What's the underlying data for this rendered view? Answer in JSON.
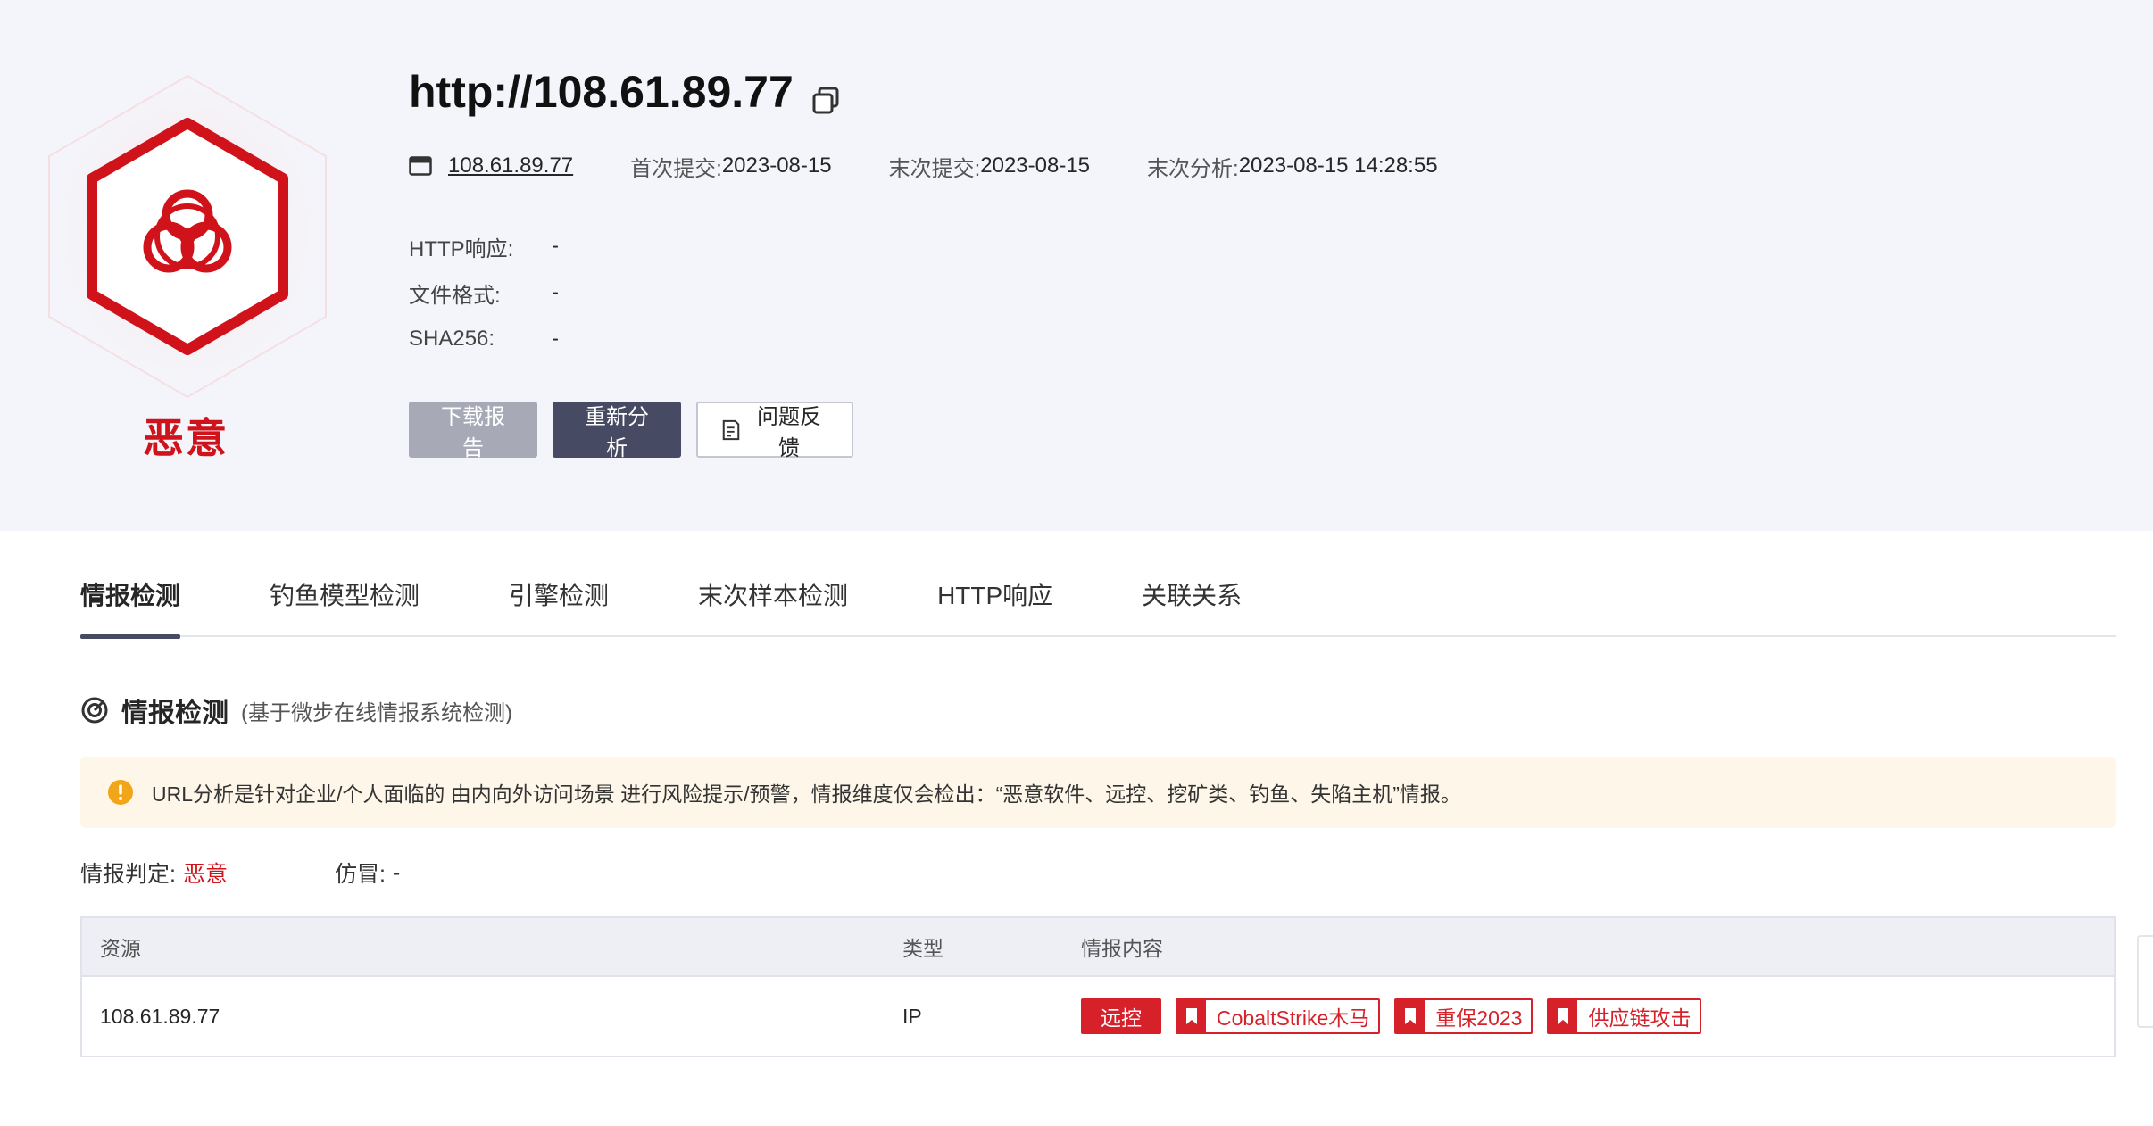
{
  "header": {
    "verdict": "恶意",
    "url": "http://108.61.89.77",
    "host": "108.61.89.77",
    "meta": [
      {
        "label": "首次提交:",
        "value": "2023-08-15"
      },
      {
        "label": "末次提交:",
        "value": "2023-08-15"
      },
      {
        "label": "末次分析:",
        "value": "2023-08-15 14:28:55"
      }
    ],
    "info": [
      {
        "label": "HTTP响应:",
        "value": "-"
      },
      {
        "label": "文件格式:",
        "value": "-"
      },
      {
        "label": "SHA256:",
        "value": "-"
      }
    ],
    "buttons": {
      "download": "下载报告",
      "reanalyze": "重新分析",
      "feedback": "问题反馈"
    }
  },
  "tabs": [
    "情报检测",
    "钓鱼模型检测",
    "引擎检测",
    "末次样本检测",
    "HTTP响应",
    "关联关系"
  ],
  "section": {
    "title": "情报检测",
    "subtitle": "(基于微步在线情报系统检测)",
    "notice": "URL分析是针对企业/个人面临的 由内向外访问场景 进行风险提示/预警，情报维度仅会检出：“恶意软件、远控、挖矿类、钓鱼、失陷主机”情报。",
    "judgement_label": "情报判定:",
    "judgement_value": "恶意",
    "spoof_label": "仿冒:",
    "spoof_value": "-"
  },
  "table": {
    "headers": [
      "资源",
      "类型",
      "情报内容"
    ],
    "rows": [
      {
        "resource": "108.61.89.77",
        "type": "IP",
        "tags": [
          "远控",
          "CobaltStrike木马",
          "重保2023",
          "供应链攻击"
        ]
      }
    ]
  },
  "colors": {
    "danger": "#d7212a",
    "header_bg": "#f4f5fa",
    "dark_button": "#474a63",
    "notice_bg": "#fdf6e9"
  }
}
